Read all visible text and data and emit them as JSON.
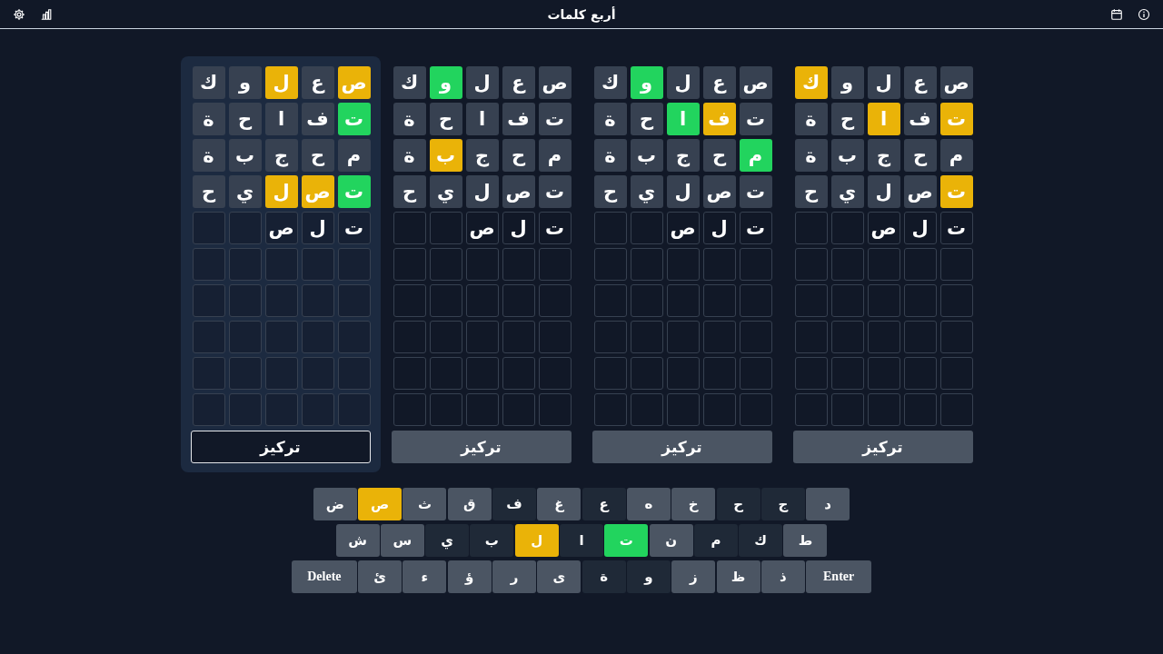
{
  "header": {
    "title": "أربع كلمات"
  },
  "boards": [
    {
      "selected": false,
      "button": "تركيز",
      "guesses": [
        [
          {
            "letter": "ص",
            "color": "#374151"
          },
          {
            "letter": "ع",
            "color": "#374151"
          },
          {
            "letter": "ل",
            "color": "#374151"
          },
          {
            "letter": "و",
            "color": "#374151"
          },
          {
            "letter": "ك",
            "color": "#eab308"
          }
        ],
        [
          {
            "letter": "ت",
            "color": "#eab308"
          },
          {
            "letter": "ف",
            "color": "#374151"
          },
          {
            "letter": "ا",
            "color": "#eab308"
          },
          {
            "letter": "ح",
            "color": "#374151"
          },
          {
            "letter": "ة",
            "color": "#374151"
          }
        ],
        [
          {
            "letter": "م",
            "color": "#374151"
          },
          {
            "letter": "ح",
            "color": "#374151"
          },
          {
            "letter": "ج",
            "color": "#374151"
          },
          {
            "letter": "ب",
            "color": "#374151"
          },
          {
            "letter": "ة",
            "color": "#374151"
          }
        ],
        [
          {
            "letter": "ت",
            "color": "#eab308"
          },
          {
            "letter": "ص",
            "color": "#374151"
          },
          {
            "letter": "ل",
            "color": "#374151"
          },
          {
            "letter": "ي",
            "color": "#374151"
          },
          {
            "letter": "ح",
            "color": "#374151"
          }
        ]
      ],
      "input": [
        "ت",
        "ل",
        "ص"
      ]
    },
    {
      "selected": false,
      "button": "تركيز",
      "guesses": [
        [
          {
            "letter": "ص",
            "color": "#374151"
          },
          {
            "letter": "ع",
            "color": "#374151"
          },
          {
            "letter": "ل",
            "color": "#374151"
          },
          {
            "letter": "و",
            "color": "#22d45e"
          },
          {
            "letter": "ك",
            "color": "#374151"
          }
        ],
        [
          {
            "letter": "ت",
            "color": "#374151"
          },
          {
            "letter": "ف",
            "color": "#eab308"
          },
          {
            "letter": "ا",
            "color": "#22d45e"
          },
          {
            "letter": "ح",
            "color": "#374151"
          },
          {
            "letter": "ة",
            "color": "#374151"
          }
        ],
        [
          {
            "letter": "م",
            "color": "#22d45e"
          },
          {
            "letter": "ح",
            "color": "#374151"
          },
          {
            "letter": "ج",
            "color": "#374151"
          },
          {
            "letter": "ب",
            "color": "#374151"
          },
          {
            "letter": "ة",
            "color": "#374151"
          }
        ],
        [
          {
            "letter": "ت",
            "color": "#374151"
          },
          {
            "letter": "ص",
            "color": "#374151"
          },
          {
            "letter": "ل",
            "color": "#374151"
          },
          {
            "letter": "ي",
            "color": "#374151"
          },
          {
            "letter": "ح",
            "color": "#374151"
          }
        ]
      ],
      "input": [
        "ت",
        "ل",
        "ص"
      ]
    },
    {
      "selected": false,
      "button": "تركيز",
      "guesses": [
        [
          {
            "letter": "ص",
            "color": "#374151"
          },
          {
            "letter": "ع",
            "color": "#374151"
          },
          {
            "letter": "ل",
            "color": "#374151"
          },
          {
            "letter": "و",
            "color": "#22d45e"
          },
          {
            "letter": "ك",
            "color": "#374151"
          }
        ],
        [
          {
            "letter": "ت",
            "color": "#374151"
          },
          {
            "letter": "ف",
            "color": "#374151"
          },
          {
            "letter": "ا",
            "color": "#374151"
          },
          {
            "letter": "ح",
            "color": "#374151"
          },
          {
            "letter": "ة",
            "color": "#374151"
          }
        ],
        [
          {
            "letter": "م",
            "color": "#374151"
          },
          {
            "letter": "ح",
            "color": "#374151"
          },
          {
            "letter": "ج",
            "color": "#374151"
          },
          {
            "letter": "ب",
            "color": "#eab308"
          },
          {
            "letter": "ة",
            "color": "#374151"
          }
        ],
        [
          {
            "letter": "ت",
            "color": "#374151"
          },
          {
            "letter": "ص",
            "color": "#374151"
          },
          {
            "letter": "ل",
            "color": "#374151"
          },
          {
            "letter": "ي",
            "color": "#374151"
          },
          {
            "letter": "ح",
            "color": "#374151"
          }
        ]
      ],
      "input": [
        "ت",
        "ل",
        "ص"
      ]
    },
    {
      "selected": true,
      "button": "تركيز",
      "guesses": [
        [
          {
            "letter": "ص",
            "color": "#eab308"
          },
          {
            "letter": "ع",
            "color": "#374151"
          },
          {
            "letter": "ل",
            "color": "#eab308"
          },
          {
            "letter": "و",
            "color": "#374151"
          },
          {
            "letter": "ك",
            "color": "#374151"
          }
        ],
        [
          {
            "letter": "ت",
            "color": "#22d45e"
          },
          {
            "letter": "ف",
            "color": "#374151"
          },
          {
            "letter": "ا",
            "color": "#374151"
          },
          {
            "letter": "ح",
            "color": "#374151"
          },
          {
            "letter": "ة",
            "color": "#374151"
          }
        ],
        [
          {
            "letter": "م",
            "color": "#374151"
          },
          {
            "letter": "ح",
            "color": "#374151"
          },
          {
            "letter": "ج",
            "color": "#374151"
          },
          {
            "letter": "ب",
            "color": "#374151"
          },
          {
            "letter": "ة",
            "color": "#374151"
          }
        ],
        [
          {
            "letter": "ت",
            "color": "#22d45e"
          },
          {
            "letter": "ص",
            "color": "#eab308"
          },
          {
            "letter": "ل",
            "color": "#eab308"
          },
          {
            "letter": "ي",
            "color": "#374151"
          },
          {
            "letter": "ح",
            "color": "#374151"
          }
        ]
      ],
      "input": [
        "ت",
        "ل",
        "ص"
      ]
    }
  ],
  "keyboard": [
    [
      {
        "label": "د",
        "color": "#4b5563"
      },
      {
        "label": "ج",
        "color": "#1f2937"
      },
      {
        "label": "ح",
        "color": "#1f2937"
      },
      {
        "label": "خ",
        "color": "#4b5563"
      },
      {
        "label": "ه",
        "color": "#4b5563"
      },
      {
        "label": "ع",
        "color": "#1f2937"
      },
      {
        "label": "غ",
        "color": "#4b5563"
      },
      {
        "label": "ف",
        "color": "#1f2937"
      },
      {
        "label": "ق",
        "color": "#4b5563"
      },
      {
        "label": "ث",
        "color": "#4b5563"
      },
      {
        "label": "ص",
        "color": "#eab308"
      },
      {
        "label": "ض",
        "color": "#4b5563"
      }
    ],
    [
      {
        "label": "ط",
        "color": "#4b5563"
      },
      {
        "label": "ك",
        "color": "#1f2937"
      },
      {
        "label": "م",
        "color": "#1f2937"
      },
      {
        "label": "ن",
        "color": "#4b5563"
      },
      {
        "label": "ت",
        "color": "#22d45e"
      },
      {
        "label": "ا",
        "color": "#1f2937"
      },
      {
        "label": "ل",
        "color": "#eab308"
      },
      {
        "label": "ب",
        "color": "#1f2937"
      },
      {
        "label": "ي",
        "color": "#1f2937"
      },
      {
        "label": "س",
        "color": "#4b5563"
      },
      {
        "label": "ش",
        "color": "#4b5563"
      }
    ],
    [
      {
        "label": "Enter",
        "color": "#4b5563",
        "kind": "wide"
      },
      {
        "label": "ذ",
        "color": "#4b5563"
      },
      {
        "label": "ظ",
        "color": "#4b5563"
      },
      {
        "label": "ز",
        "color": "#4b5563"
      },
      {
        "label": "و",
        "color": "#1f2937"
      },
      {
        "label": "ة",
        "color": "#1f2937"
      },
      {
        "label": "ى",
        "color": "#4b5563"
      },
      {
        "label": "ر",
        "color": "#4b5563"
      },
      {
        "label": "ؤ",
        "color": "#4b5563"
      },
      {
        "label": "ء",
        "color": "#4b5563"
      },
      {
        "label": "ئ",
        "color": "#4b5563"
      },
      {
        "label": "Delete",
        "color": "#4b5563",
        "kind": "wide"
      }
    ]
  ]
}
